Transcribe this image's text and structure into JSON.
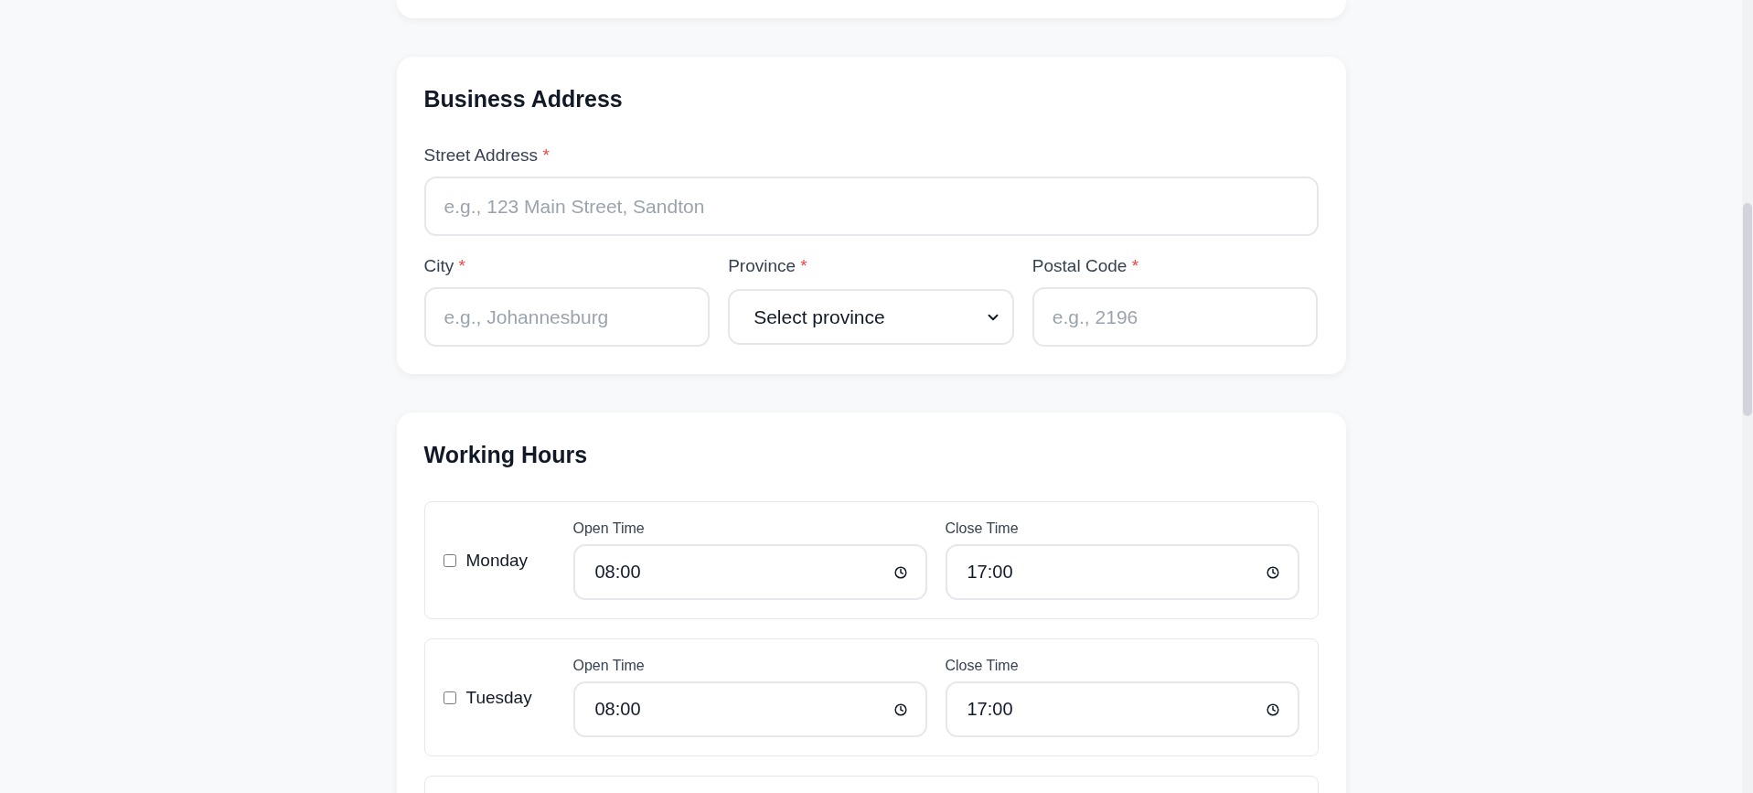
{
  "address": {
    "title": "Business Address",
    "street": {
      "kind": "text",
      "label": "Street Address",
      "required_mark": "*",
      "placeholder": "e.g., 123 Main Street, Sandton"
    },
    "fields": [
      {
        "kind": "text",
        "label": "City",
        "required_mark": "*",
        "placeholder": "e.g., Johannesburg"
      },
      {
        "kind": "select",
        "label": "Province",
        "required_mark": "*",
        "value": "Select province"
      },
      {
        "kind": "text",
        "label": "Postal Code",
        "required_mark": "*",
        "placeholder": "e.g., 2196"
      }
    ]
  },
  "hours": {
    "title": "Working Hours",
    "days": [
      {
        "name": "Monday",
        "checked": false,
        "open_label": "Open Time",
        "open": "08:00",
        "close_label": "Close Time",
        "close": "17:00"
      },
      {
        "name": "Tuesday",
        "checked": false,
        "open_label": "Open Time",
        "open": "08:00",
        "close_label": "Close Time",
        "close": "17:00"
      }
    ]
  }
}
